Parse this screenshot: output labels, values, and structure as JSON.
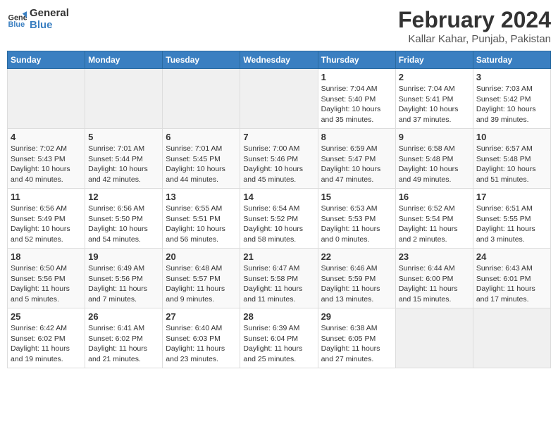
{
  "logo": {
    "line1": "General",
    "line2": "Blue"
  },
  "title": "February 2024",
  "subtitle": "Kallar Kahar, Punjab, Pakistan",
  "weekdays": [
    "Sunday",
    "Monday",
    "Tuesday",
    "Wednesday",
    "Thursday",
    "Friday",
    "Saturday"
  ],
  "weeks": [
    [
      {
        "day": "",
        "info": ""
      },
      {
        "day": "",
        "info": ""
      },
      {
        "day": "",
        "info": ""
      },
      {
        "day": "",
        "info": ""
      },
      {
        "day": "1",
        "info": "Sunrise: 7:04 AM\nSunset: 5:40 PM\nDaylight: 10 hours\nand 35 minutes."
      },
      {
        "day": "2",
        "info": "Sunrise: 7:04 AM\nSunset: 5:41 PM\nDaylight: 10 hours\nand 37 minutes."
      },
      {
        "day": "3",
        "info": "Sunrise: 7:03 AM\nSunset: 5:42 PM\nDaylight: 10 hours\nand 39 minutes."
      }
    ],
    [
      {
        "day": "4",
        "info": "Sunrise: 7:02 AM\nSunset: 5:43 PM\nDaylight: 10 hours\nand 40 minutes."
      },
      {
        "day": "5",
        "info": "Sunrise: 7:01 AM\nSunset: 5:44 PM\nDaylight: 10 hours\nand 42 minutes."
      },
      {
        "day": "6",
        "info": "Sunrise: 7:01 AM\nSunset: 5:45 PM\nDaylight: 10 hours\nand 44 minutes."
      },
      {
        "day": "7",
        "info": "Sunrise: 7:00 AM\nSunset: 5:46 PM\nDaylight: 10 hours\nand 45 minutes."
      },
      {
        "day": "8",
        "info": "Sunrise: 6:59 AM\nSunset: 5:47 PM\nDaylight: 10 hours\nand 47 minutes."
      },
      {
        "day": "9",
        "info": "Sunrise: 6:58 AM\nSunset: 5:48 PM\nDaylight: 10 hours\nand 49 minutes."
      },
      {
        "day": "10",
        "info": "Sunrise: 6:57 AM\nSunset: 5:48 PM\nDaylight: 10 hours\nand 51 minutes."
      }
    ],
    [
      {
        "day": "11",
        "info": "Sunrise: 6:56 AM\nSunset: 5:49 PM\nDaylight: 10 hours\nand 52 minutes."
      },
      {
        "day": "12",
        "info": "Sunrise: 6:56 AM\nSunset: 5:50 PM\nDaylight: 10 hours\nand 54 minutes."
      },
      {
        "day": "13",
        "info": "Sunrise: 6:55 AM\nSunset: 5:51 PM\nDaylight: 10 hours\nand 56 minutes."
      },
      {
        "day": "14",
        "info": "Sunrise: 6:54 AM\nSunset: 5:52 PM\nDaylight: 10 hours\nand 58 minutes."
      },
      {
        "day": "15",
        "info": "Sunrise: 6:53 AM\nSunset: 5:53 PM\nDaylight: 11 hours\nand 0 minutes."
      },
      {
        "day": "16",
        "info": "Sunrise: 6:52 AM\nSunset: 5:54 PM\nDaylight: 11 hours\nand 2 minutes."
      },
      {
        "day": "17",
        "info": "Sunrise: 6:51 AM\nSunset: 5:55 PM\nDaylight: 11 hours\nand 3 minutes."
      }
    ],
    [
      {
        "day": "18",
        "info": "Sunrise: 6:50 AM\nSunset: 5:56 PM\nDaylight: 11 hours\nand 5 minutes."
      },
      {
        "day": "19",
        "info": "Sunrise: 6:49 AM\nSunset: 5:56 PM\nDaylight: 11 hours\nand 7 minutes."
      },
      {
        "day": "20",
        "info": "Sunrise: 6:48 AM\nSunset: 5:57 PM\nDaylight: 11 hours\nand 9 minutes."
      },
      {
        "day": "21",
        "info": "Sunrise: 6:47 AM\nSunset: 5:58 PM\nDaylight: 11 hours\nand 11 minutes."
      },
      {
        "day": "22",
        "info": "Sunrise: 6:46 AM\nSunset: 5:59 PM\nDaylight: 11 hours\nand 13 minutes."
      },
      {
        "day": "23",
        "info": "Sunrise: 6:44 AM\nSunset: 6:00 PM\nDaylight: 11 hours\nand 15 minutes."
      },
      {
        "day": "24",
        "info": "Sunrise: 6:43 AM\nSunset: 6:01 PM\nDaylight: 11 hours\nand 17 minutes."
      }
    ],
    [
      {
        "day": "25",
        "info": "Sunrise: 6:42 AM\nSunset: 6:02 PM\nDaylight: 11 hours\nand 19 minutes."
      },
      {
        "day": "26",
        "info": "Sunrise: 6:41 AM\nSunset: 6:02 PM\nDaylight: 11 hours\nand 21 minutes."
      },
      {
        "day": "27",
        "info": "Sunrise: 6:40 AM\nSunset: 6:03 PM\nDaylight: 11 hours\nand 23 minutes."
      },
      {
        "day": "28",
        "info": "Sunrise: 6:39 AM\nSunset: 6:04 PM\nDaylight: 11 hours\nand 25 minutes."
      },
      {
        "day": "29",
        "info": "Sunrise: 6:38 AM\nSunset: 6:05 PM\nDaylight: 11 hours\nand 27 minutes."
      },
      {
        "day": "",
        "info": ""
      },
      {
        "day": "",
        "info": ""
      }
    ]
  ]
}
